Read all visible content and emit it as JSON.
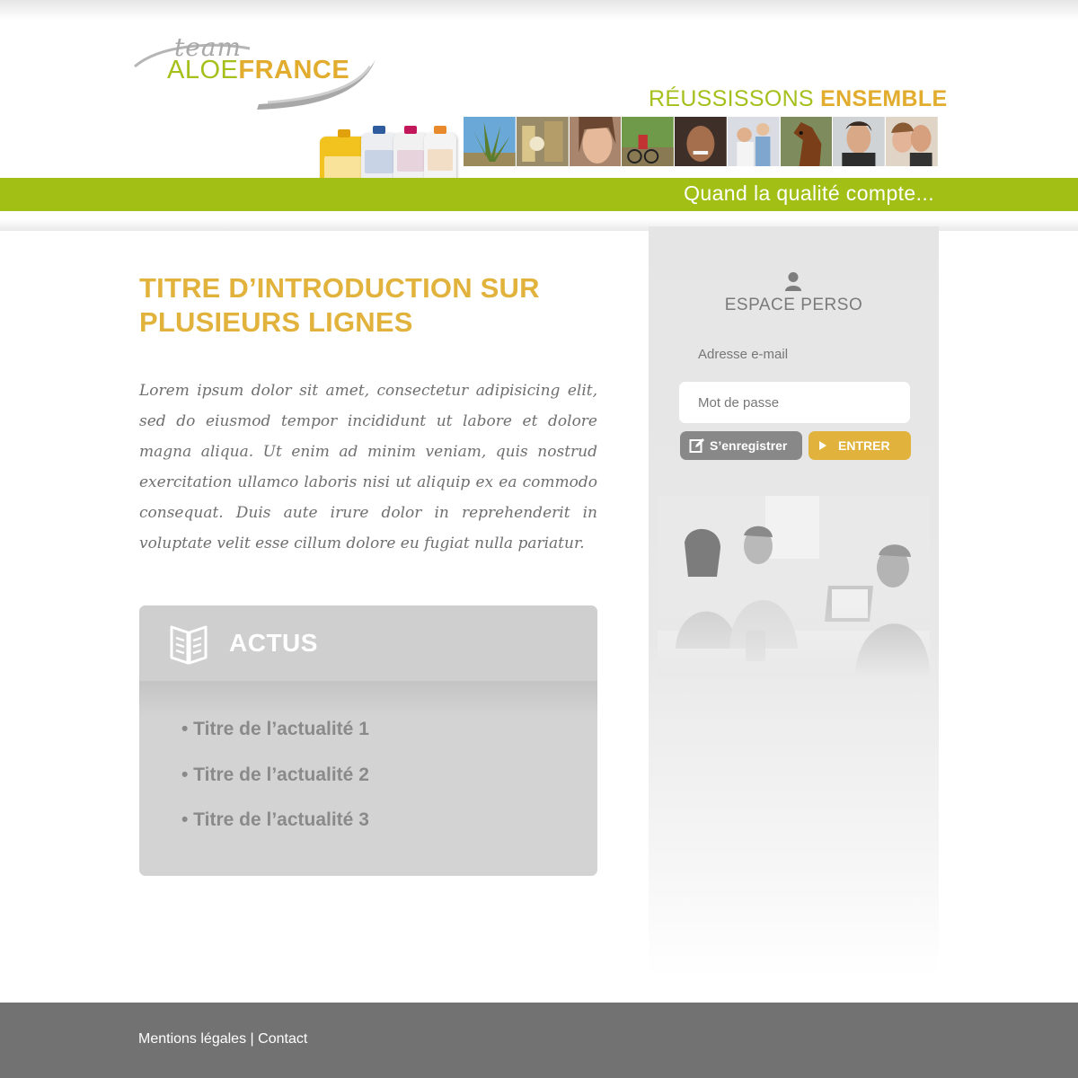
{
  "brand": {
    "logo_team": "team",
    "logo_aloe": "ALOE",
    "logo_france": "FRANCE"
  },
  "header": {
    "tagline_part1": "RÉUSSISSONS",
    "tagline_part2": "ENSEMBLE",
    "slogan": "Quand la qualité compte..."
  },
  "intro": {
    "title": "TITRE D’INTRODUCTION SUR PLUSIEURS LIGNES",
    "text": "Lorem ipsum dolor sit amet, consectetur adipisicing elit, sed do eiusmod tempor incididunt ut labore et dolore magna aliqua. Ut enim ad minim veniam, quis nostrud exercitation ullamco laboris nisi ut aliquip ex ea commodo consequat. Duis aute irure dolor in reprehenderit in voluptate velit esse cillum dolore eu fugiat nulla pariatur."
  },
  "actus": {
    "title": "ACTUS",
    "icon": "book-icon",
    "items": [
      {
        "label": "• Titre de l’actualité 1"
      },
      {
        "label": "• Titre de l’actualité 2"
      },
      {
        "label": "• Titre de l’actualité 3"
      }
    ]
  },
  "sidebar": {
    "title": "ESPACE PERSO",
    "user_icon": "user-icon",
    "email_placeholder": "Adresse e-mail",
    "password_placeholder": "Mot de passe",
    "register_label": "S’enregistrer",
    "enter_label": "ENTRER"
  },
  "footer": {
    "legal_label": "Mentions légales",
    "separator": "|",
    "contact_label": "Contact"
  },
  "colors": {
    "green": "#a2bf16",
    "gold": "#e2b33c",
    "grey_button": "#888888",
    "footer": "#727272"
  }
}
